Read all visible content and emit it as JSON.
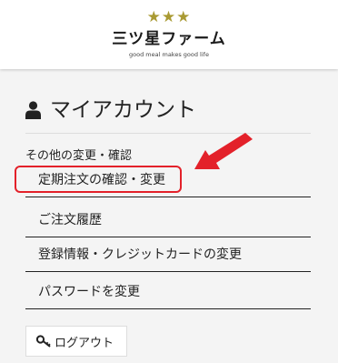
{
  "header": {
    "brand_name": "三ツ星ファーム",
    "tagline": "good meal makes good life",
    "stars_icon": "three-stars-icon",
    "star_color": "#a99a33"
  },
  "account": {
    "title": "マイアカウント",
    "icon": "user-icon"
  },
  "section": {
    "label": "その他の変更・確認"
  },
  "menu": [
    {
      "label": "定期注文の確認・変更"
    },
    {
      "label": "ご注文履歴"
    },
    {
      "label": "登録情報・クレジットカードの変更"
    },
    {
      "label": "パスワードを変更"
    }
  ],
  "logout": {
    "label": "ログアウト",
    "icon": "key-icon"
  },
  "annotation": {
    "color": "#e3212a"
  }
}
